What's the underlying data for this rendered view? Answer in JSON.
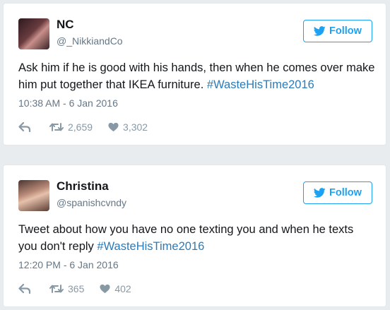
{
  "tweets": [
    {
      "name": "NC",
      "handle": "@_NikkiandCo",
      "follow_label": "Follow",
      "text_plain": "Ask him if he is good with his hands, then when he comes over make him put together that IKEA furniture. ",
      "hashtag": "#WasteHisTime2016",
      "text_tail": "",
      "timestamp": "10:38 AM - 6 Jan 2016",
      "retweets": "2,659",
      "likes": "3,302"
    },
    {
      "name": "Christina",
      "handle": "@spanishcvndy",
      "follow_label": "Follow",
      "text_plain": "Tweet about how you have no one texting you and when he texts you don't reply ",
      "hashtag": "#WasteHisTime2016",
      "text_tail": "",
      "timestamp": "12:20 PM - 6 Jan 2016",
      "retweets": "365",
      "likes": "402"
    }
  ],
  "colors": {
    "accent": "#1da1f2",
    "hashtag": "#2b7bb9",
    "muted": "#657786",
    "icon": "#8899a6"
  },
  "icons": [
    "twitter-bird-icon",
    "reply-icon",
    "retweet-icon",
    "heart-icon"
  ]
}
